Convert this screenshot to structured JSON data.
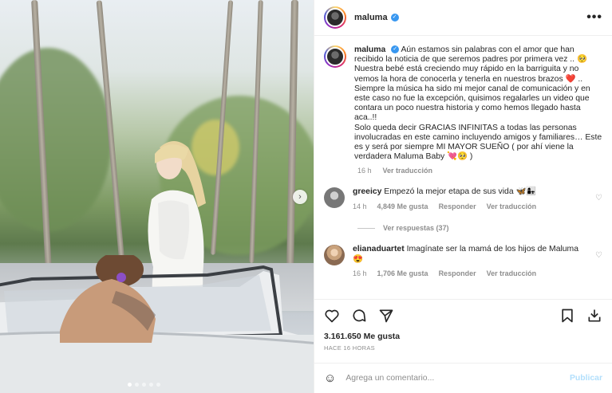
{
  "header": {
    "username": "maluma",
    "more_label": "•••"
  },
  "caption": {
    "username": "maluma",
    "lines": [
      "Aún estamos sin palabras con el amor que han recibido la noticia de que seremos padres por primera vez .. 🥺",
      "Nuestra bebé está creciendo muy rápido en la barriguita y no vemos la hora de conocerla y tenerla en nuestros brazos ❤️ ..",
      "Siempre la música ha sido mi mejor canal de comunicación y en este caso no fue la excepción, quisimos regalarles un video que contara un poco nuestra historia y como hemos llegado hasta aca..!!",
      "Solo queda decir GRACIAS INFINITAS a todas las personas involucradas en este camino incluyendo amigos y familiares… Este es y será por siempre MI MAYOR SUEÑO ( por ahí viene la verdadera Maluma Baby 💘🥺 )"
    ],
    "time": "16 h",
    "translate": "Ver traducción"
  },
  "comments": [
    {
      "username": "greeicy",
      "text": "Empezó la mejor etapa de sus vida 🦋👩‍👧",
      "time": "14 h",
      "likes": "4,849 Me gusta",
      "reply": "Responder",
      "translate": "Ver traducción",
      "replies": "Ver respuestas (37)"
    },
    {
      "username": "elianaduartet",
      "text": "Imagínate ser la mamá de los hijos de Maluma 😍",
      "time": "16 h",
      "likes": "1,706 Me gusta",
      "reply": "Responder",
      "translate": "Ver traducción"
    }
  ],
  "post": {
    "likes": "3.161.650 Me gusta",
    "ago": "HACE 16 HORAS"
  },
  "composer": {
    "placeholder": "Agrega un comentario...",
    "publish": "Publicar"
  },
  "colors": {
    "verified": "#3897f0",
    "muted": "#8e8e8e",
    "publish_disabled": "#b2dffc"
  }
}
